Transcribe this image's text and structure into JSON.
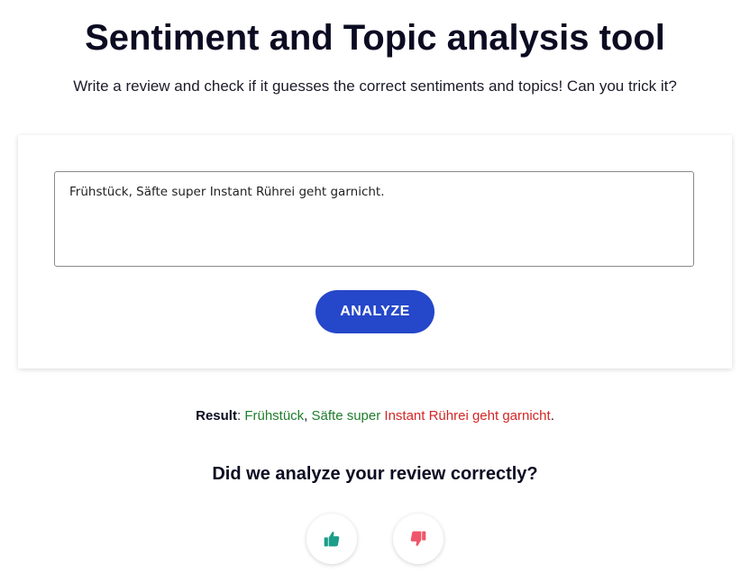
{
  "header": {
    "title": "Sentiment and Topic analysis tool",
    "subtitle": "Write a review and check if it guesses the correct sentiments and topics! Can you trick it?"
  },
  "form": {
    "review_text": "Frühstück, Säfte super Instant Rührei geht garnicht.",
    "analyze_label": "ANALYZE"
  },
  "result": {
    "label": "Result",
    "separator": ": ",
    "segments": {
      "seg0": "Frühstück",
      "seg1": ",",
      "seg2": " Säfte super",
      "seg3": " Instant Rührei geht garnicht",
      "seg4": "."
    }
  },
  "feedback": {
    "question": "Did we analyze your review correctly?",
    "thumbs_up_icon": "thumbs-up-icon",
    "thumbs_down_icon": "thumbs-down-icon"
  },
  "colors": {
    "accent": "#2547c9",
    "positive": "#1e7d2c",
    "negative": "#d42525",
    "thumbs_up": "#1a9e8a",
    "thumbs_down": "#f0566a"
  }
}
